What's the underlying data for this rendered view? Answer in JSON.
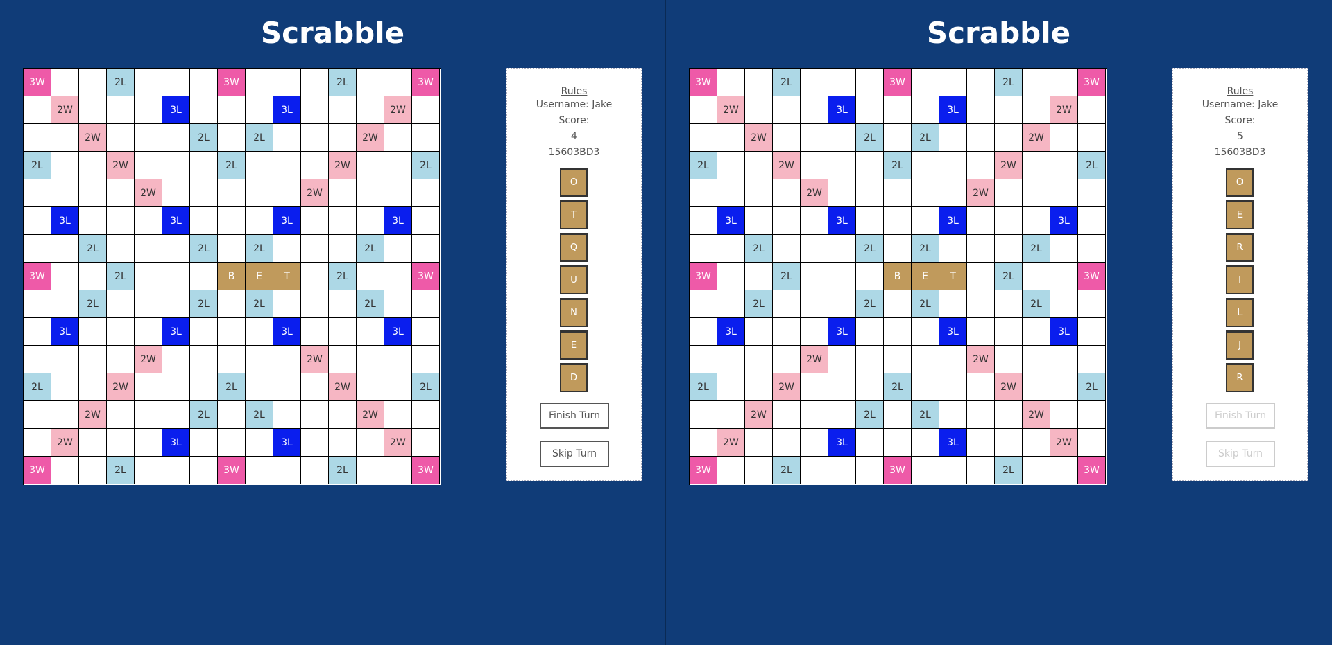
{
  "panes": [
    {
      "title": "Scrabble",
      "rules_label": "Rules",
      "username_line": "Username: Jake",
      "score_label": "Score:",
      "score_value": "4",
      "game_code": "15603BD3",
      "rack": [
        "O",
        "T",
        "Q",
        "U",
        "N",
        "E",
        "D"
      ],
      "finish_label": "Finish Turn",
      "skip_label": "Skip Turn",
      "buttons_disabled": false
    },
    {
      "title": "Scrabble",
      "rules_label": "Rules",
      "username_line": "Username: Jake",
      "score_label": "Score:",
      "score_value": "5",
      "game_code": "15603BD3",
      "rack": [
        "O",
        "E",
        "R",
        "I",
        "L",
        "J",
        "R"
      ],
      "finish_label": "Finish Turn",
      "skip_label": "Skip Turn",
      "buttons_disabled": true
    }
  ],
  "board": {
    "rows": [
      [
        "3W",
        "",
        "",
        "2L",
        "",
        "",
        "",
        "3W",
        "",
        "",
        "",
        "2L",
        "",
        "",
        "3W"
      ],
      [
        "",
        "2W",
        "",
        "",
        "",
        "3L",
        "",
        "",
        "",
        "3L",
        "",
        "",
        "",
        "2W",
        ""
      ],
      [
        "",
        "",
        "2W",
        "",
        "",
        "",
        "2L",
        "",
        "2L",
        "",
        "",
        "",
        "2W",
        "",
        ""
      ],
      [
        "2L",
        "",
        "",
        "2W",
        "",
        "",
        "",
        "2L",
        "",
        "",
        "",
        "2W",
        "",
        "",
        "2L"
      ],
      [
        "",
        "",
        "",
        "",
        "2W",
        "",
        "",
        "",
        "",
        "",
        "2W",
        "",
        "",
        "",
        ""
      ],
      [
        "",
        "3L",
        "",
        "",
        "",
        "3L",
        "",
        "",
        "",
        "3L",
        "",
        "",
        "",
        "3L",
        ""
      ],
      [
        "",
        "",
        "2L",
        "",
        "",
        "",
        "2L",
        "",
        "2L",
        "",
        "",
        "",
        "2L",
        "",
        ""
      ],
      [
        "3W",
        "",
        "",
        "2L",
        "",
        "",
        "",
        "B",
        "E",
        "T",
        "",
        "2L",
        "",
        "",
        "3W"
      ],
      [
        "",
        "",
        "2L",
        "",
        "",
        "",
        "2L",
        "",
        "2L",
        "",
        "",
        "",
        "2L",
        "",
        ""
      ],
      [
        "",
        "3L",
        "",
        "",
        "",
        "3L",
        "",
        "",
        "",
        "3L",
        "",
        "",
        "",
        "3L",
        ""
      ],
      [
        "",
        "",
        "",
        "",
        "2W",
        "",
        "",
        "",
        "",
        "",
        "2W",
        "",
        "",
        "",
        ""
      ],
      [
        "2L",
        "",
        "",
        "2W",
        "",
        "",
        "",
        "2L",
        "",
        "",
        "",
        "2W",
        "",
        "",
        "2L"
      ],
      [
        "",
        "",
        "2W",
        "",
        "",
        "",
        "2L",
        "",
        "2L",
        "",
        "",
        "",
        "2W",
        "",
        ""
      ],
      [
        "",
        "2W",
        "",
        "",
        "",
        "3L",
        "",
        "",
        "",
        "3L",
        "",
        "",
        "",
        "2W",
        ""
      ],
      [
        "3W",
        "",
        "",
        "2L",
        "",
        "",
        "",
        "3W",
        "",
        "",
        "",
        "2L",
        "",
        "",
        "3W"
      ]
    ],
    "premium_codes": [
      "3W",
      "2W",
      "3L",
      "2L"
    ]
  },
  "colors": {
    "background": "#103c78",
    "triple_word": "#ee5aa8",
    "double_word": "#f6b6c3",
    "double_letter": "#add8e6",
    "triple_letter": "#0a1eee",
    "tile": "#c09a5c"
  }
}
